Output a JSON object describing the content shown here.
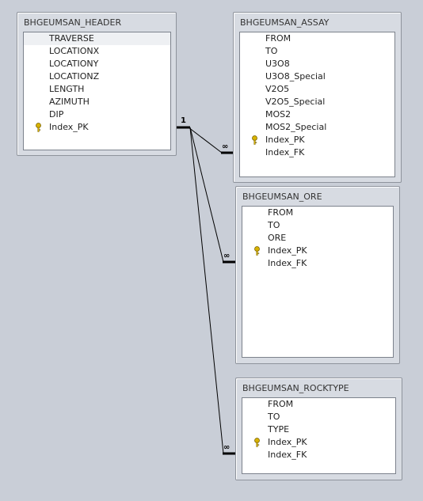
{
  "tables": {
    "header": {
      "title": "BHGEUMSAN_HEADER",
      "fields": [
        {
          "name": "TRAVERSE",
          "key": false
        },
        {
          "name": "LOCATIONX",
          "key": false
        },
        {
          "name": "LOCATIONY",
          "key": false
        },
        {
          "name": "LOCATIONZ",
          "key": false
        },
        {
          "name": "LENGTH",
          "key": false
        },
        {
          "name": "AZIMUTH",
          "key": false
        },
        {
          "name": "DIP",
          "key": false
        },
        {
          "name": "Index_PK",
          "key": true
        }
      ]
    },
    "assay": {
      "title": "BHGEUMSAN_ASSAY",
      "fields": [
        {
          "name": "FROM",
          "key": false
        },
        {
          "name": "TO",
          "key": false
        },
        {
          "name": "U3O8",
          "key": false
        },
        {
          "name": "U3O8_Special",
          "key": false
        },
        {
          "name": "V2O5",
          "key": false
        },
        {
          "name": "V2O5_Special",
          "key": false
        },
        {
          "name": "MOS2",
          "key": false
        },
        {
          "name": "MOS2_Special",
          "key": false
        },
        {
          "name": "Index_PK",
          "key": true
        },
        {
          "name": "Index_FK",
          "key": false
        }
      ]
    },
    "ore": {
      "title": "BHGEUMSAN_ORE",
      "fields": [
        {
          "name": "FROM",
          "key": false
        },
        {
          "name": "TO",
          "key": false
        },
        {
          "name": "ORE",
          "key": false
        },
        {
          "name": "Index_PK",
          "key": true
        },
        {
          "name": "Index_FK",
          "key": false
        }
      ]
    },
    "rocktype": {
      "title": "BHGEUMSAN_ROCKTYPE",
      "fields": [
        {
          "name": "FROM",
          "key": false
        },
        {
          "name": "TO",
          "key": false
        },
        {
          "name": "TYPE",
          "key": false
        },
        {
          "name": "Index_PK",
          "key": true
        },
        {
          "name": "Index_FK",
          "key": false
        }
      ]
    }
  },
  "relationships": {
    "one_label": "1",
    "many_label": "∞"
  },
  "colors": {
    "workspace": "#c9ced7",
    "key_icon": "#d8b300"
  }
}
